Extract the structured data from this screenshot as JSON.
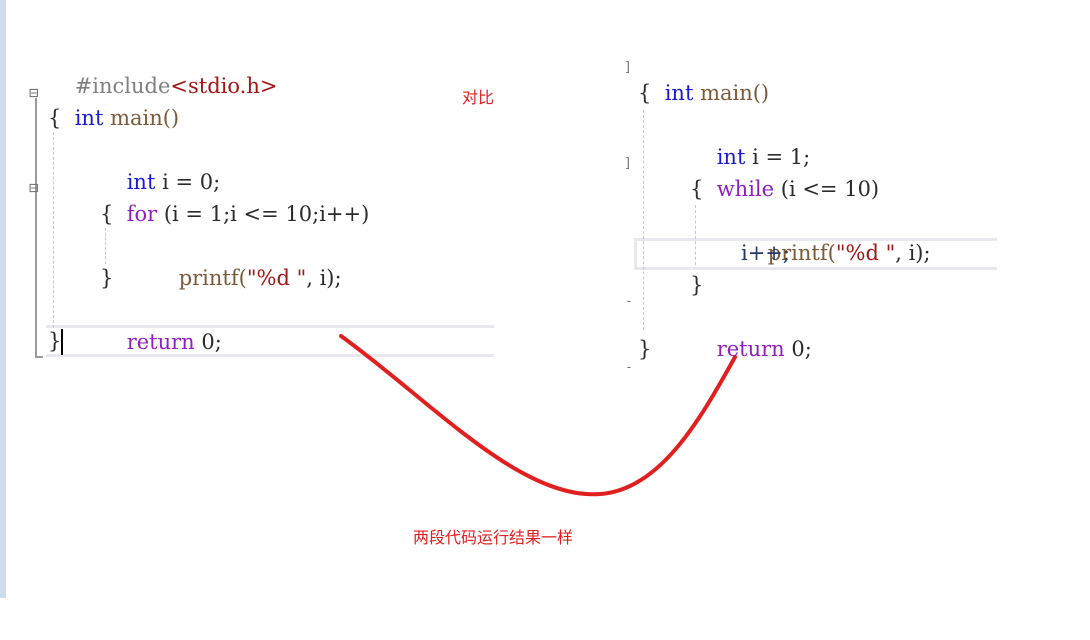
{
  "left_code": {
    "include_directive": "#include",
    "include_header": "<stdio.h>",
    "lines": [
      {
        "kw": "int",
        "rest": " main()"
      },
      {
        "text": "{"
      },
      {
        "kw": "int",
        "rest": " i = 0;"
      },
      {
        "ctl": "for",
        "rest": " (i = 1;i <= 10;i++)"
      },
      {
        "text": "{"
      },
      {
        "fn": "printf",
        "open": "(",
        "str": "\"%d \"",
        "rest": ", i);"
      },
      {
        "text": "}"
      },
      {
        "ctl": "return",
        "rest": " 0;"
      },
      {
        "text": "}"
      }
    ]
  },
  "right_code": {
    "lines": [
      {
        "kw": "int",
        "rest": " main()"
      },
      {
        "text": "{"
      },
      {
        "kw": "int",
        "rest": " i = 1;"
      },
      {
        "ctl": "while",
        "rest": " (i <= 10)"
      },
      {
        "text": "{"
      },
      {
        "fn": "printf",
        "open": "(",
        "str": "\"%d \"",
        "rest": ", i);"
      },
      {
        "text": "i++;"
      },
      {
        "text": "}"
      },
      {
        "ctl": "return",
        "rest": " 0;"
      },
      {
        "text": "}"
      }
    ]
  },
  "annotations": {
    "compare_label": "对比",
    "conclusion_label": "两段代码运行结果一样",
    "accent_color": "#e02020"
  },
  "fold_icons": {
    "collapse": "⊟",
    "end": "-"
  }
}
